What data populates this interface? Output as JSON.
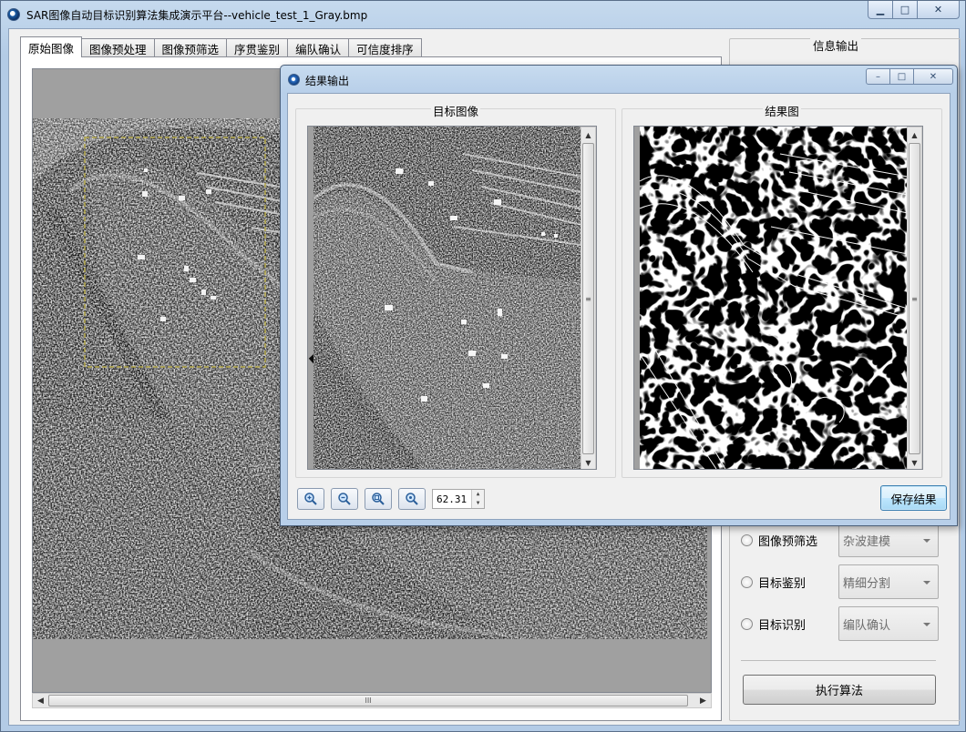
{
  "window": {
    "title": "SAR图像自动目标识别算法集成演示平台--vehicle_test_1_Gray.bmp",
    "min": "▁",
    "max": "□",
    "close": "✕"
  },
  "tabs": [
    {
      "label": "原始图像",
      "active": true
    },
    {
      "label": "图像预处理",
      "active": false
    },
    {
      "label": "图像预筛选",
      "active": false
    },
    {
      "label": "序贯鉴别",
      "active": false
    },
    {
      "label": "编队确认",
      "active": false
    },
    {
      "label": "可信度排序",
      "active": false
    }
  ],
  "scrollbar": {
    "grip": "III",
    "left": "◀",
    "right": "▶"
  },
  "info_panel": {
    "legend": "信息输出",
    "rows": [
      {
        "label": "图像预筛选",
        "value": "杂波建模"
      },
      {
        "label": "目标鉴别",
        "value": "精细分割"
      },
      {
        "label": "目标识别",
        "value": "编队确认"
      }
    ],
    "run_button": "执行算法"
  },
  "result_window": {
    "title": "结果输出",
    "min": "–",
    "max": "□",
    "close": "✕",
    "target_group": "目标图像",
    "result_group": "结果图",
    "zoom_value": "62.31",
    "save_button": "保存结果",
    "tools": [
      {
        "name": "zoom-in-icon"
      },
      {
        "name": "zoom-out-icon"
      },
      {
        "name": "zoom-fit-icon"
      },
      {
        "name": "zoom-actual-icon"
      }
    ]
  },
  "colors": {
    "titlebar": "#b9d1ea",
    "selection_box": "#b5a94a",
    "image_bg": "#a0a0a0"
  }
}
